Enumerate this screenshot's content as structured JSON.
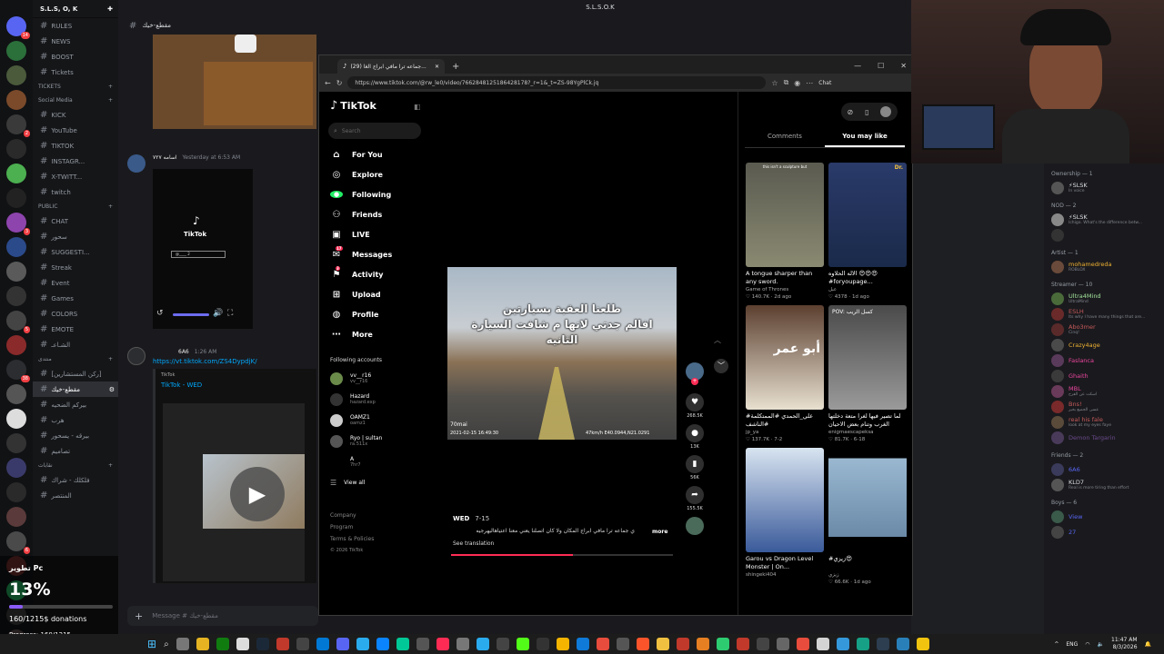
{
  "window_title": "S.L.S.O.K",
  "server": {
    "name": "S.L.S, O, K"
  },
  "channels": [
    {
      "label": "RULES"
    },
    {
      "label": "NEWS"
    },
    {
      "label": "BOOST"
    },
    {
      "label": "Tickets"
    }
  ],
  "categories": {
    "tickets": "TICKETS",
    "social": "Social Media",
    "public": "PUBLIC",
    "ar1": "منتدى",
    "ar2": "نقابات"
  },
  "social_channels": [
    {
      "label": "KICK"
    },
    {
      "label": "YouTube"
    },
    {
      "label": "TIKTOK"
    },
    {
      "label": "INSTAGR..."
    },
    {
      "label": "X-TWITT..."
    },
    {
      "label": "twitch"
    }
  ],
  "public_channels": [
    {
      "label": "CHAT"
    },
    {
      "label": "سحور"
    },
    {
      "label": "SUGGESTI..."
    },
    {
      "label": "Streak"
    },
    {
      "label": "Event"
    },
    {
      "label": "Games"
    },
    {
      "label": "COLORS"
    },
    {
      "label": "EMOTE"
    },
    {
      "label": "الشـاعـ"
    }
  ],
  "ar_channels": [
    {
      "label": "[ركن المستشارين]"
    },
    {
      "label": "مقطع-خيك"
    },
    {
      "label": "بيركم الضحيه"
    },
    {
      "label": "هرب"
    },
    {
      "label": "بيرقه - يسحور"
    },
    {
      "label": "تصاميم"
    }
  ],
  "ar2_channels": [
    {
      "label": "فلكلك - شراك"
    },
    {
      "label": "المنتصر"
    }
  ],
  "chat": {
    "channel_header": "مقطع-خيك",
    "msg1": {
      "author": "اسامه ٧٢٧",
      "time": "Yesterday at 6:53 AM"
    },
    "tiktok_card": {
      "brand": "TikTok",
      "handle": "@____ 2"
    },
    "msg2": {
      "author": "6A6",
      "time": "1:26 AM",
      "link": "https://vt.tiktok.com/ZS4DypdjK/",
      "embed_site": "TikTok",
      "embed_title": "TikTok - WED"
    },
    "input_placeholder": "Message # مقطع-خيك"
  },
  "browser": {
    "tab_title": "(29) جماعه ترا مافي ابراج الغا...",
    "url": "https://www.tiktok.com/@rw_le0/video/7662848125186428178?_r=1&_t=ZS-98YgPlCk.jq",
    "chat_label": "Chat"
  },
  "tiktok": {
    "logo": "TikTok",
    "search_placeholder": "Search",
    "nav": [
      {
        "label": "For You",
        "icon": "home-icon"
      },
      {
        "label": "Explore",
        "icon": "compass-icon"
      },
      {
        "label": "Following",
        "icon": "following-icon"
      },
      {
        "label": "Friends",
        "icon": "friends-icon"
      },
      {
        "label": "LIVE",
        "icon": "live-icon"
      },
      {
        "label": "Messages",
        "icon": "messages-icon",
        "badge": "17"
      },
      {
        "label": "Activity",
        "icon": "activity-icon",
        "badge": "3"
      },
      {
        "label": "Upload",
        "icon": "upload-icon"
      },
      {
        "label": "Profile",
        "icon": "profile-icon"
      },
      {
        "label": "More",
        "icon": "more-icon"
      }
    ],
    "following_header": "Following accounts",
    "following": [
      {
        "name": "vv__r16",
        "sub": "vv__r16"
      },
      {
        "name": "Hazard",
        "sub": "hazard.exp"
      },
      {
        "name": "OAMZ1",
        "sub": "oamz1"
      },
      {
        "name": "Ryo | sultan",
        "sub": "ra.511x"
      },
      {
        "name": "A",
        "sub": "7hr7"
      }
    ],
    "view_all": "View all",
    "footer": [
      "Company",
      "Program",
      "Terms & Policies",
      "© 2026 TikTok"
    ],
    "video": {
      "overlay_text_1": "طلعنا العقبة بسيارتين",
      "overlay_text_2": "افالم جدتي لانها م شافت السيارة",
      "overlay_text_3": "الثانيه",
      "dashcam_left": "2021-02-15 16:49:30",
      "dashcam_right": "47km/h E40.0944,N21.0291",
      "dashcam_brand": "70mai",
      "author": "WED",
      "date": "7-15",
      "caption": "ي جماعه ترا مافي ابراج المكان ولا كان اتصلنا يعني معنا اعتياهاليهرجيه",
      "more": "more",
      "see_translation": "See translation",
      "progress": 0.55
    },
    "actions": {
      "likes": "268.5K",
      "comments": "13K",
      "saves": "56K",
      "shares": "155.5K"
    },
    "tabs": {
      "comments": "Comments",
      "you_may_like": "You may like"
    },
    "cards": [
      {
        "title": "A tongue sharper than any sword.",
        "user": "Game of Thrones",
        "likes": "140.7K",
        "age": "2d ago",
        "thumb_text": "this isn't a sculpture but"
      },
      {
        "title": "الاله الحلاوه 😍😍😍 #foryoupage...",
        "user": "عبل",
        "likes": "4378",
        "age": "1d ago",
        "thumb_text": "Dr."
      },
      {
        "title": "#علي_الحمدي #الممتكلمة #الناشف",
        "user": "jp_ya",
        "likes": "137.7K",
        "age": "7-2",
        "thumb_text": "أبو عمر"
      },
      {
        "title": "لما تصير فيها لغرا متعة دخلتها الغرب وتنام بعض الاحيان",
        "user": "enigmaescapeksa",
        "likes": "81.7K",
        "age": "6-18",
        "thumb_text": "POV: كسل الريب"
      },
      {
        "title": "Garou vs Dragon Level Monster | On...",
        "user": "shingeki404",
        "likes": "",
        "age": "",
        "thumb_text": ""
      },
      {
        "title": "#زيزي😍",
        "user": "زيزي",
        "likes": "66.6K",
        "age": "1d ago",
        "thumb_text": ""
      }
    ]
  },
  "members": {
    "groups": [
      {
        "label": "Ownership — 1",
        "members": [
          {
            "name": "⚡SLSK",
            "sub": "In voice",
            "color": "#dbdee1"
          }
        ]
      },
      {
        "label": "NOD — 2",
        "members": [
          {
            "name": "⚡SLSK",
            "sub": "Ichigo. What's the difference betw...",
            "color": "#dbdee1"
          },
          {
            "name": "",
            "sub": "",
            "color": "#dbdee1"
          }
        ]
      },
      {
        "label": "Artist — 1",
        "members": [
          {
            "name": "mohamedreda",
            "sub": "ROBLOX",
            "color": "#f0b232"
          }
        ]
      },
      {
        "label": "Streamer — 10",
        "members": [
          {
            "name": "Ultra4Mind",
            "sub": "UltraMind",
            "color": "#a4e39c"
          },
          {
            "name": "ESLH",
            "sub": "Its why I have many things that are...",
            "color": "#c65a5a"
          },
          {
            "name": "Abo3mer",
            "sub": "Cinq!",
            "color": "#c65a5a"
          },
          {
            "name": "Crazy4age",
            "sub": "",
            "color": "#f0b232"
          },
          {
            "name": "Faslanca",
            "sub": "",
            "color": "#eb459e"
          },
          {
            "name": "Ghaith",
            "sub": "",
            "color": "#eb459e"
          },
          {
            "name": "MBL",
            "sub": "اسكت عن الفرح",
            "color": "#eb459e"
          },
          {
            "name": "Bns!",
            "sub": "عسى الجميع بخير",
            "color": "#c65a5a"
          },
          {
            "name": "real his fale",
            "sub": "look at my eyes faye",
            "color": "#c65a5a"
          },
          {
            "name": "Demon Targarin",
            "sub": "",
            "color": "#6c4a8c"
          }
        ]
      },
      {
        "label": "Friends — 2",
        "members": [
          {
            "name": "6A6",
            "sub": "",
            "color": "#5865f2"
          },
          {
            "name": "KLD7",
            "sub": "Real is more tiring than effort",
            "color": "#dbdee1"
          }
        ]
      },
      {
        "label": "Boys — 6",
        "members": [
          {
            "name": "View",
            "sub": "",
            "color": "#5865f2"
          },
          {
            "name": "27",
            "sub": "",
            "color": "#5865f2"
          }
        ]
      }
    ]
  },
  "overlay": {
    "title": "تطوير Pc",
    "percent": "13%",
    "fraction": 0.13,
    "donations": "160/1215$ donations",
    "progress": "Progress: 160/1215"
  },
  "taskbar": {
    "lang": "ENG",
    "time": "11:47 AM",
    "date": "8/3/2026"
  }
}
